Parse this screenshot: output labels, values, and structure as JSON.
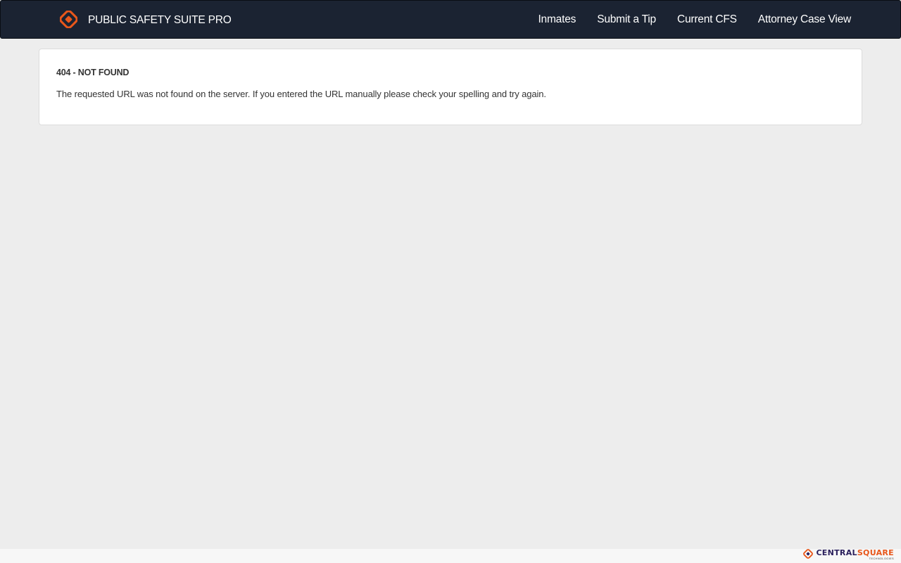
{
  "header": {
    "brand_name": "PUBLIC SAFETY SUITE PRO",
    "brand_icon": "centralsquare-diamond-icon",
    "nav_links": [
      {
        "label": "Inmates"
      },
      {
        "label": "Submit a Tip"
      },
      {
        "label": "Current CFS"
      },
      {
        "label": "Attorney Case View"
      }
    ]
  },
  "error": {
    "title": "404 - NOT FOUND",
    "message": "The requested URL was not found on the server. If you entered the URL manually please check your spelling and try again."
  },
  "footer": {
    "logo_icon": "centralsquare-diamond-icon",
    "company_name_part1": "CENTRAL",
    "company_name_part2": "SQUARE",
    "company_subtitle": "TECHNOLOGIES"
  },
  "colors": {
    "navbar": "#1b2332",
    "accent": "#e8571b",
    "background": "#ededed",
    "panel": "#ffffff"
  }
}
